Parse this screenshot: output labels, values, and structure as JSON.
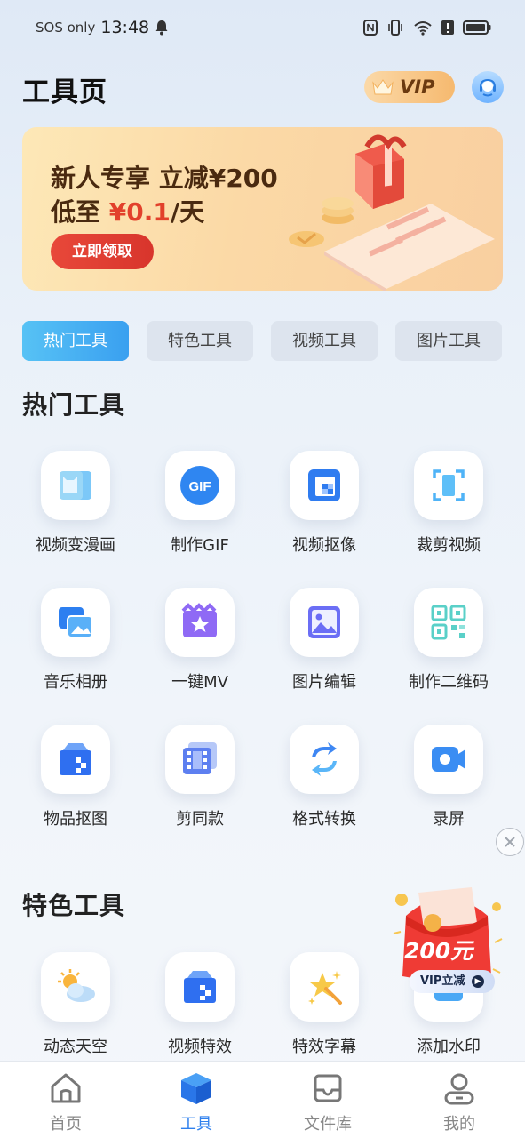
{
  "status_bar": {
    "carrier": "SOS only",
    "time": "13:48"
  },
  "header": {
    "title": "工具页",
    "vip_label": "VIP"
  },
  "banner": {
    "line1": "新人专享 立减¥200",
    "line2_prefix": "低至 ",
    "line2_price": "¥0.1",
    "line2_suffix": "/天",
    "button": "立即领取"
  },
  "tabs": [
    {
      "label": "热门工具",
      "active": true
    },
    {
      "label": "特色工具",
      "active": false
    },
    {
      "label": "视频工具",
      "active": false
    },
    {
      "label": "图片工具",
      "active": false
    }
  ],
  "sections": {
    "hot_title": "热门工具",
    "feature_title": "特色工具"
  },
  "hot_tools": [
    {
      "label": "视频变漫画",
      "icon": "video-to-comic-icon"
    },
    {
      "label": "制作GIF",
      "icon": "gif-icon",
      "icon_text": "GIF"
    },
    {
      "label": "视频抠像",
      "icon": "video-matting-icon"
    },
    {
      "label": "裁剪视频",
      "icon": "crop-video-icon"
    },
    {
      "label": "音乐相册",
      "icon": "music-album-icon"
    },
    {
      "label": "一键MV",
      "icon": "mv-icon"
    },
    {
      "label": "图片编辑",
      "icon": "image-edit-icon"
    },
    {
      "label": "制作二维码",
      "icon": "qr-code-icon"
    },
    {
      "label": "物品抠图",
      "icon": "object-cutout-icon"
    },
    {
      "label": "剪同款",
      "icon": "template-edit-icon"
    },
    {
      "label": "格式转换",
      "icon": "format-convert-icon"
    },
    {
      "label": "录屏",
      "icon": "screen-record-icon"
    }
  ],
  "feature_tools": [
    {
      "label": "动态天空",
      "icon": "dynamic-sky-icon"
    },
    {
      "label": "视频特效",
      "icon": "video-effect-icon"
    },
    {
      "label": "特效字幕",
      "icon": "effect-subtitle-icon"
    },
    {
      "label": "添加水印",
      "icon": "watermark-icon"
    }
  ],
  "promo": {
    "amount": "200元",
    "pill": "VIP立减"
  },
  "bottom_nav": [
    {
      "label": "首页",
      "icon": "home-icon",
      "active": false
    },
    {
      "label": "工具",
      "icon": "tools-cube-icon",
      "active": true
    },
    {
      "label": "文件库",
      "icon": "file-library-icon",
      "active": false
    },
    {
      "label": "我的",
      "icon": "profile-icon",
      "active": false
    }
  ],
  "colors": {
    "accent": "#2f80ed",
    "tab_active": "#3aa0f0",
    "banner_button": "#e2402b"
  }
}
